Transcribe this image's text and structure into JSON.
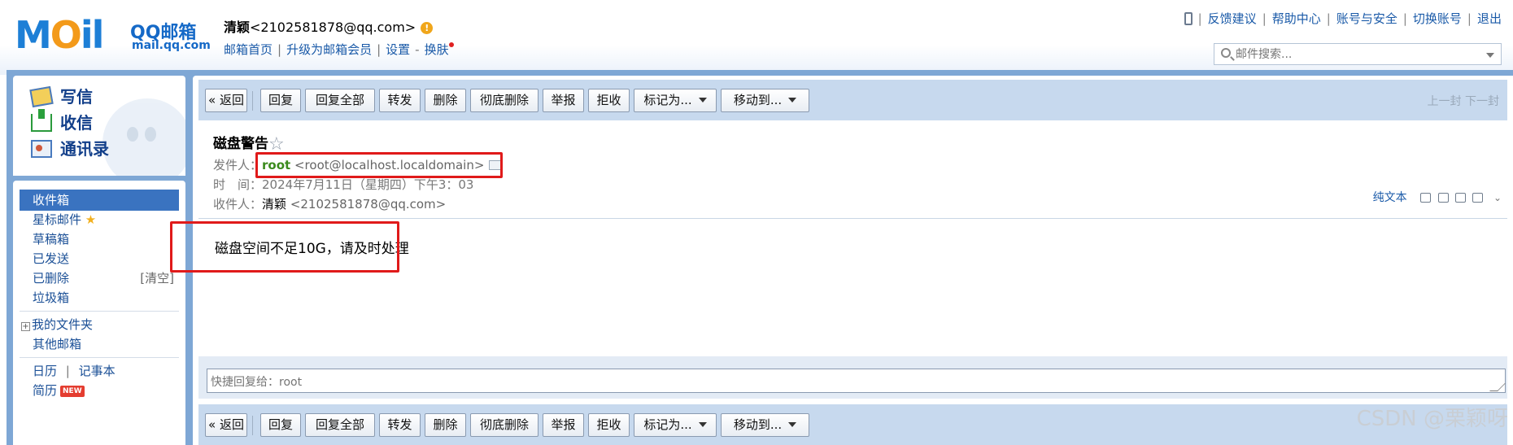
{
  "header": {
    "logo_text_left": "M",
    "logo_text_o": "O",
    "logo_text_right": "il",
    "logo_qq": "QQ邮箱",
    "logo_url": "mail.qq.com",
    "account_name": "清颖",
    "account_email": "<2102581878@qq.com>",
    "warn_glyph": "!",
    "nav": [
      "邮箱首页",
      "升级为邮箱会员",
      "设置",
      "换肤"
    ],
    "nav_dash": "-",
    "top_links": [
      "反馈建议",
      "帮助中心",
      "账号与安全",
      "切换账号",
      "退出"
    ],
    "search_placeholder": "邮件搜索..."
  },
  "sidebar": {
    "actions": [
      "写信",
      "收信",
      "通讯录"
    ],
    "folders": {
      "inbox": "收件箱",
      "starred": "星标邮件",
      "drafts": "草稿箱",
      "sent": "已发送",
      "deleted": "已删除",
      "deleted_clear": "[清空]",
      "spam": "垃圾箱",
      "my_folders": "我的文件夹",
      "other_mail": "其他邮箱",
      "calendar": "日历",
      "calendar_sep": "|",
      "notes": "记事本",
      "resume": "简历",
      "new_badge": "NEW"
    }
  },
  "toolbar": {
    "back": "« 返回",
    "reply": "回复",
    "reply_all": "回复全部",
    "forward": "转发",
    "delete": "删除",
    "delete_forever": "彻底删除",
    "report": "举报",
    "reject": "拒收",
    "mark_as": "标记为...",
    "move_to": "移动到...",
    "prev_next": "上一封 下一封"
  },
  "email": {
    "subject": "磁盘警告",
    "star_glyph": "☆",
    "from_label": "发件人：",
    "from_name": "root",
    "from_addr": "<root@localhost.localdomain>",
    "time_label": "时　间：",
    "time_value": "2024年7月11日（星期四）下午3：03",
    "to_label": "收件人：",
    "to_name": "清颖",
    "to_addr": "<2102581878@qq.com>",
    "plain_text": "纯文本",
    "body": "磁盘空间不足10G，请及时处理"
  },
  "quick_reply": {
    "placeholder": "快捷回复给：root"
  },
  "watermark": "CSDN @栗颖呀",
  "colors": {
    "frame": "#7ea7d5",
    "toolbar": "#c7d9ee",
    "link": "#1a5aa8",
    "sender_green": "#3b8a1d",
    "highlight_red": "#e01a1a"
  }
}
